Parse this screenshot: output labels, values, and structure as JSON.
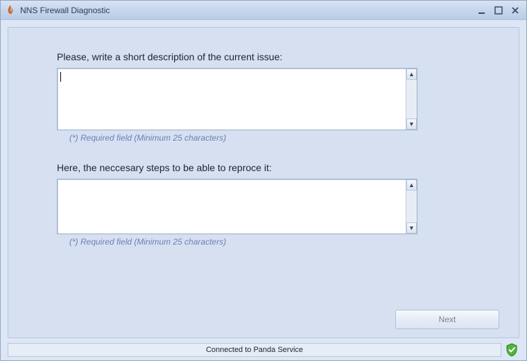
{
  "window": {
    "title": "NNS Firewall Diagnostic"
  },
  "form": {
    "description": {
      "label": "Please, write a short description of the current issue:",
      "value": "",
      "hint": "(*) Required field (Minimum 25 characters)"
    },
    "steps": {
      "label": "Here, the neccesary steps to be able to reproce it:",
      "value": "",
      "hint": "(*) Required field (Minimum 25 characters)"
    },
    "next_label": "Next"
  },
  "status": {
    "text": "Connected to Panda Service"
  },
  "icons": {
    "app": "flame-icon",
    "status": "shield-check-icon"
  }
}
